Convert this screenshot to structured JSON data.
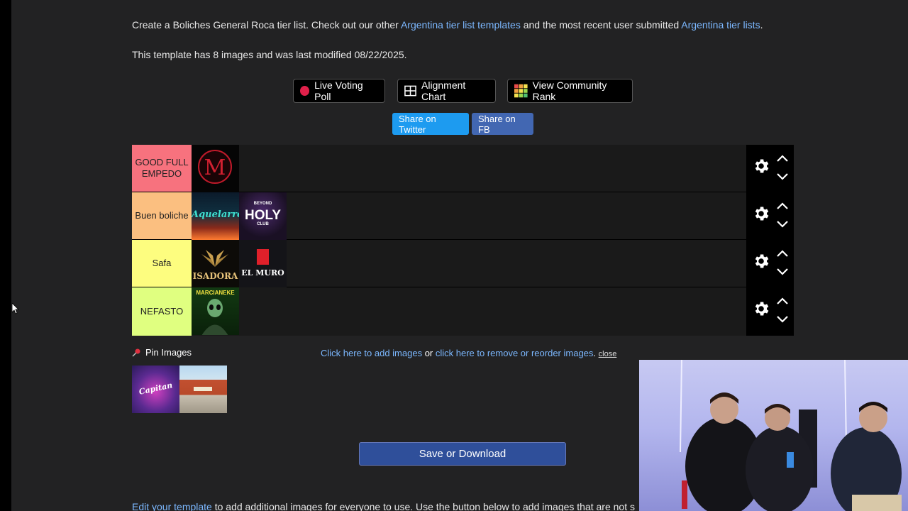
{
  "intro": {
    "prefix": "Create a Boliches General Roca tier list. Check out our other ",
    "link1": "Argentina tier list templates",
    "middle": " and the most recent user submitted ",
    "link2": "Argentina tier lists",
    "suffix": "."
  },
  "meta_text": "This template has 8 images and was last modified 08/22/2025.",
  "buttons": {
    "live_voting": "Live Voting Poll",
    "alignment_chart": "Alignment Chart",
    "community_rank": "View Community Rank",
    "share_twitter": "Share on Twitter",
    "share_fb": "Share on FB"
  },
  "tiers": [
    {
      "label": "GOOD FULL EMPEDO",
      "color": "#f7727e",
      "items": [
        "M"
      ]
    },
    {
      "label": "Buen boliche",
      "color": "#fbbf80",
      "items": [
        "Aquelarre",
        "HOLY"
      ]
    },
    {
      "label": "Safa",
      "color": "#fdfd7f",
      "items": [
        "ISADORA",
        "EL MURO"
      ]
    },
    {
      "label": "NEFASTO",
      "color": "#e0ff80",
      "items": [
        "MARCIANEKE"
      ]
    }
  ],
  "thumb_text": {
    "holy_top": "BEYOND",
    "holy_main": "HOLY",
    "holy_sub": "CLUB",
    "isadora": "ISADORA",
    "elmuro": "EL MURO",
    "marcianeke": "MARCIANEKE",
    "pin_sticker": "Capitan"
  },
  "pin_label": "Pin Images",
  "add_images": {
    "link1": "Click here to add images",
    "or": " or ",
    "link2": "click here to remove or reorder images",
    "dot": ". ",
    "close": "close"
  },
  "save_label": "Save or Download",
  "footer": {
    "link": "Edit your template",
    "text": " to add additional images for everyone to use. Use the button below to add images that are not s"
  },
  "colors": {
    "link": "#7cb8ff",
    "twitter": "#1d9bf0",
    "facebook": "#4267b2",
    "save": "#2f4f9a"
  },
  "icons": [
    "red-dot-icon",
    "grid-icon",
    "color-grid-icon",
    "gear-icon",
    "chevron-up-icon",
    "chevron-down-icon",
    "pin-icon",
    "cursor-icon"
  ]
}
